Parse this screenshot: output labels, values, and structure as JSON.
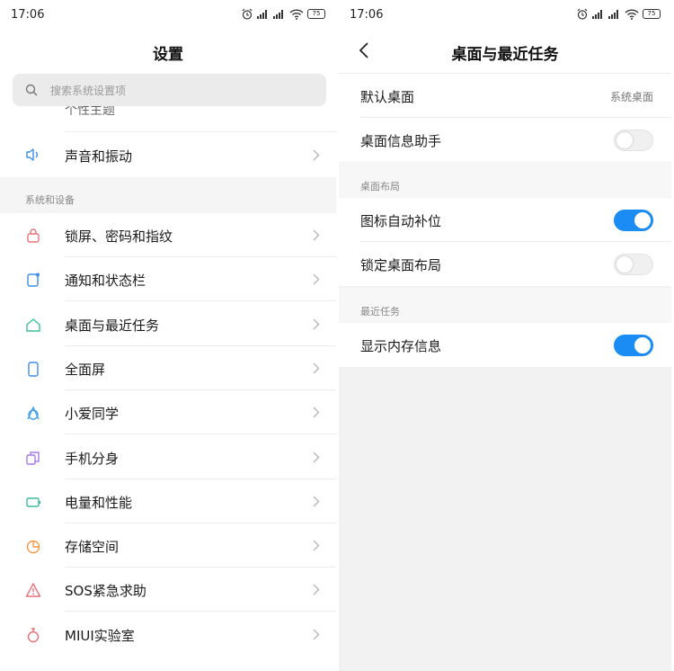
{
  "left": {
    "status": {
      "time": "17:06",
      "battery": "75"
    },
    "title": "设置",
    "search": {
      "placeholder": "搜索系统设置项"
    },
    "cut_item": "个性主题",
    "sound_item": "声音和振动",
    "section_label": "系统和设备",
    "items": [
      {
        "label": "锁屏、密码和指纹",
        "icon": "lock-icon",
        "color": "#e8727a"
      },
      {
        "label": "通知和状态栏",
        "icon": "notification-icon",
        "color": "#3f8fe8"
      },
      {
        "label": "桌面与最近任务",
        "icon": "home-icon",
        "color": "#3cbf9a"
      },
      {
        "label": "全面屏",
        "icon": "phone-icon",
        "color": "#3f8fe8"
      },
      {
        "label": "小爱同学",
        "icon": "assistant-icon",
        "color": "#3fa0e8"
      },
      {
        "label": "手机分身",
        "icon": "dual-space-icon",
        "color": "#a57be8"
      },
      {
        "label": "电量和性能",
        "icon": "battery-icon",
        "color": "#3cbf9a"
      },
      {
        "label": "存储空间",
        "icon": "storage-icon",
        "color": "#f09a4a"
      },
      {
        "label": "SOS紧急求助",
        "icon": "sos-icon",
        "color": "#e8727a"
      },
      {
        "label": "MIUI实验室",
        "icon": "lab-icon",
        "color": "#e8727a"
      }
    ]
  },
  "right": {
    "status": {
      "time": "17:06",
      "battery": "75"
    },
    "title": "桌面与最近任务",
    "default_launcher": {
      "label": "默认桌面",
      "value": "系统桌面"
    },
    "desktop_assistant": {
      "label": "桌面信息助手",
      "on": false
    },
    "layout_header": "桌面布局",
    "auto_fill": {
      "label": "图标自动补位",
      "on": true
    },
    "lock_layout": {
      "label": "锁定桌面布局",
      "on": false
    },
    "recents_header": "最近任务",
    "show_memory": {
      "label": "显示内存信息",
      "on": true
    }
  },
  "colors": {
    "accent": "#1a8cf4",
    "toggle_off": "#f0f0f0"
  }
}
